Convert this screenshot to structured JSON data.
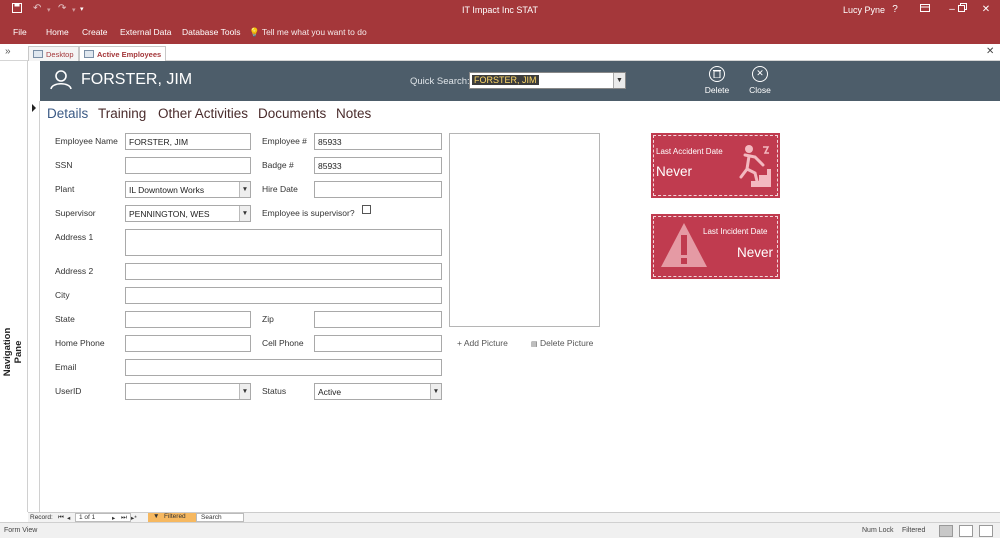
{
  "titlebar": {
    "title": "IT Impact Inc STAT",
    "user": "Lucy Pyne",
    "help": "?"
  },
  "ribbon": {
    "tabs": [
      "File",
      "Home",
      "Create",
      "External Data",
      "Database Tools"
    ],
    "tell_me": "Tell me what you want to do"
  },
  "doctabs": [
    "Desktop",
    "Active Employees"
  ],
  "nav_pane": {
    "label": "Navigation Pane"
  },
  "header": {
    "employee_name": "FORSTER, JIM",
    "quick_search_label": "Quick Search:",
    "quick_search_value": "FORSTER, JIM",
    "delete_label": "Delete",
    "close_label": "Close"
  },
  "subtabs": [
    "Details",
    "Training",
    "Other Activities",
    "Documents",
    "Notes"
  ],
  "form": {
    "employee_name_label": "Employee Name",
    "employee_name_value": "FORSTER, JIM",
    "employee_no_label": "Employee #",
    "employee_no_value": "85933",
    "ssn_label": "SSN",
    "ssn_value": "",
    "badge_label": "Badge #",
    "badge_value": "85933",
    "plant_label": "Plant",
    "plant_value": "IL Downtown Works",
    "hire_date_label": "Hire Date",
    "hire_date_value": "",
    "supervisor_label": "Supervisor",
    "supervisor_value": "PENNINGTON, WES",
    "is_supervisor_label": "Employee is supervisor?",
    "is_supervisor_checked": false,
    "address1_label": "Address 1",
    "address2_label": "Address 2",
    "city_label": "City",
    "state_label": "State",
    "zip_label": "Zip",
    "home_phone_label": "Home Phone",
    "cell_phone_label": "Cell Phone",
    "email_label": "Email",
    "userid_label": "UserID",
    "status_label": "Status",
    "status_value": "Active"
  },
  "picture": {
    "add_label": "Add Picture",
    "delete_label": "Delete Picture"
  },
  "cards": {
    "accident_label": "Last Accident Date",
    "accident_value": "Never",
    "incident_label": "Last Incident Date",
    "incident_value": "Never",
    "color": "#c03b4f"
  },
  "record_nav": {
    "record_label": "Record:",
    "position": "1 of 1",
    "filter_label": "Filtered",
    "search_label": "Search"
  },
  "statusbar": {
    "view": "Form View",
    "num_lock": "Num Lock",
    "filtered": "Filtered"
  },
  "colors": {
    "accent": "#a4373a",
    "header_bg": "#4d5d6a"
  }
}
